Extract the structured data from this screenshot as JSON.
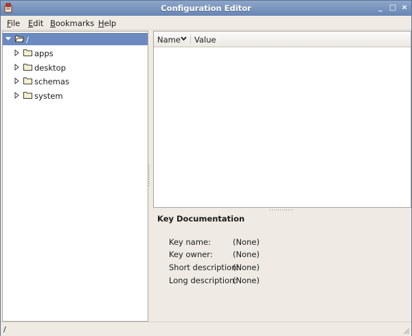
{
  "window": {
    "title": "Configuration Editor",
    "minimize_glyph": "_",
    "maximize_glyph": "□",
    "close_glyph": "×"
  },
  "menubar": {
    "file": {
      "mnemonic": "F",
      "rest": "ile"
    },
    "edit": {
      "mnemonic": "E",
      "rest": "dit"
    },
    "bookmarks": {
      "mnemonic": "B",
      "rest": "ookmarks"
    },
    "help": {
      "mnemonic": "H",
      "rest": "elp"
    }
  },
  "tree": {
    "root": {
      "label": "/",
      "expanded": true,
      "selected": true
    },
    "children": [
      {
        "label": "apps"
      },
      {
        "label": "desktop"
      },
      {
        "label": "schemas"
      },
      {
        "label": "system"
      }
    ]
  },
  "table": {
    "columns": [
      {
        "label": "Name",
        "sorted": true
      },
      {
        "label": "Value"
      }
    ],
    "rows": []
  },
  "key_documentation": {
    "title": "Key Documentation",
    "fields": [
      {
        "label": "Key name:",
        "value": "(None)"
      },
      {
        "label": "Key owner:",
        "value": "(None)"
      },
      {
        "label": "Short description:",
        "value": "(None)"
      },
      {
        "label": "Long description:",
        "value": "(None)"
      }
    ]
  },
  "statusbar": {
    "path": "/"
  },
  "colors": {
    "titlebar": "#6785b4",
    "selection": "#6c8ac0",
    "window_bg": "#efebe4",
    "folder": "#f5f0d0"
  }
}
